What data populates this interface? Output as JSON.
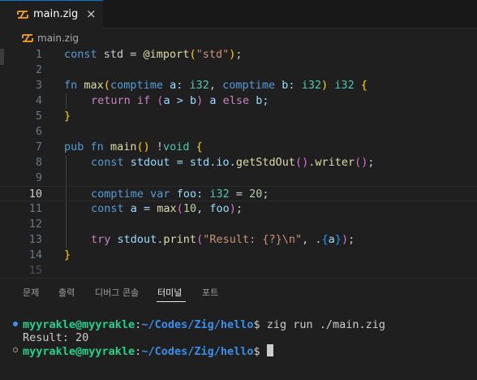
{
  "editor_tab": {
    "filename": "main.zig",
    "close_label": "×"
  },
  "breadcrumb": {
    "filename": "main.zig"
  },
  "code": {
    "current_line": 10,
    "line_numbers": [
      "1",
      "2",
      "3",
      "4",
      "5",
      "6",
      "7",
      "8",
      "9",
      "10",
      "11",
      "12",
      "13",
      "14",
      "15"
    ],
    "l1": {
      "kw": "const",
      "a": " std = ",
      "fn": "@import",
      "p1": "(",
      "s": "\"std\"",
      "p2": ")",
      "end": ";"
    },
    "l3": {
      "kw": "fn",
      "sp": " ",
      "fn": "max",
      "p1": "(",
      "k1": "comptime",
      "a1": " a: ",
      "t1": "i32",
      "c": ", ",
      "k2": "comptime",
      "a2": " b: ",
      "t2": "i32",
      "p2": ")",
      "sp2": " ",
      "t3": "i32",
      "sp3": " ",
      "br": "{"
    },
    "l4": {
      "k1": "return",
      "sp": " ",
      "k2": "if",
      "sp2": " ",
      "p1": "(",
      "a": "a > b",
      "p2": ")",
      "a2": " a ",
      "k3": "else",
      "a3": " b;"
    },
    "l5": {
      "br": "}"
    },
    "l7": {
      "kw": "pub",
      "sp": " ",
      "kw2": "fn",
      "sp2": " ",
      "fn": "main",
      "p": "()",
      "a": " !",
      "t": "void",
      "sp3": " ",
      "br": "{"
    },
    "l8": {
      "kw": "const",
      "a": " stdout = std.io.",
      "fn": "getStdOut",
      "p1": "()",
      "d": ".",
      "fn2": "writer",
      "p2": "()",
      "end": ";"
    },
    "l10": {
      "kw": "comptime",
      "sp": " ",
      "kw2": "var",
      "a": " foo: ",
      "t": "i32",
      "a2": " = ",
      "n": "20",
      "end": ";"
    },
    "l11": {
      "kw": "const",
      "a": " a = ",
      "fn": "max",
      "p1": "(",
      "n": "10",
      "a2": ", foo",
      "p2": ")",
      "end": ";"
    },
    "l13": {
      "kw": "try",
      "a": " stdout.",
      "fn": "print",
      "p1": "(",
      "s": "\"Result: {?}\\n\"",
      "a2": ", .",
      "b": "{",
      "v": "a",
      "b2": "}",
      "p2": ")",
      "end": ";"
    },
    "l14": {
      "br": "}"
    }
  },
  "panel": {
    "tabs": [
      "문제",
      "출력",
      "디버그 콘솔",
      "터미널",
      "포트"
    ],
    "active_tab": "터미널"
  },
  "terminal": {
    "user_host": "myyrakle@myyrakle",
    "sep": ":",
    "path": "~/Codes/Zig/hello",
    "prompt_char": "$",
    "command": " zig run ./main.zig",
    "output": "Result: 20"
  },
  "colors": {
    "accent": "#0078d4",
    "zig_icon": "#f7a41d",
    "terminal_user": "#23d18b",
    "terminal_path": "#3b8eea"
  },
  "icons": {
    "file_icon": "zig-icon",
    "close_icon": "close-icon"
  }
}
